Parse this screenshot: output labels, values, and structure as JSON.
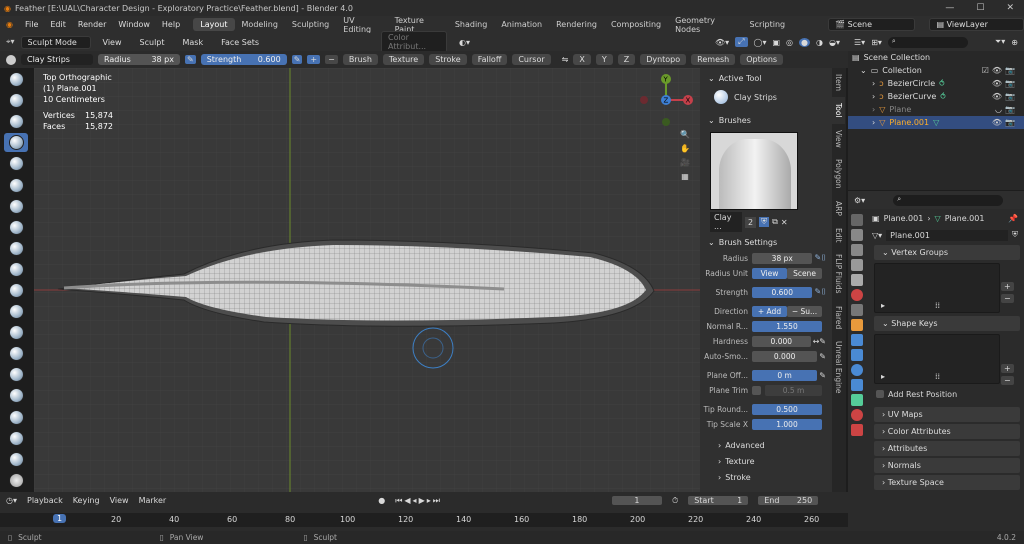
{
  "title": "Feather [E:\\UAL\\Character Design - Exploratory Practice\\Feather.blend] - Blender 4.0",
  "menus": [
    "File",
    "Edit",
    "Render",
    "Window",
    "Help"
  ],
  "workspaces": [
    "Layout",
    "Modeling",
    "Sculpting",
    "UV Editing",
    "Texture Paint",
    "Shading",
    "Animation",
    "Rendering",
    "Compositing",
    "Geometry Nodes",
    "Scripting"
  ],
  "scene": "Scene",
  "viewlayer": "ViewLayer",
  "vpmenu": {
    "mode": "Sculpt Mode",
    "items": [
      "View",
      "Sculpt",
      "Mask",
      "Face Sets"
    ],
    "color_attr": "Color Attribut..."
  },
  "toolhdr": {
    "brush": "Clay Strips",
    "radius_label": "Radius",
    "radius": "38 px",
    "strength_label": "Strength",
    "strength": "0.600",
    "menus": [
      "Brush",
      "Texture",
      "Stroke",
      "Falloff",
      "Cursor"
    ],
    "sym": [
      "X",
      "Y",
      "Z"
    ],
    "dyntopo": "Dyntopo",
    "remesh": "Remesh",
    "options": "Options"
  },
  "vpinfo": {
    "l1": "Top Orthographic",
    "l2": "(1) Plane.001",
    "l3": "10 Centimeters",
    "vlabel": "Vertices",
    "v": "15,874",
    "flabel": "Faces",
    "f": "15,872"
  },
  "gizmo": {
    "x": "X",
    "y": "Y",
    "z": "Z"
  },
  "npanel": {
    "active_tool": "Active Tool",
    "tool": "Clay Strips",
    "brushes": "Brushes",
    "brush_name": "Clay ...",
    "brush_users": "2",
    "brush_settings": "Brush Settings",
    "props": [
      {
        "l": "Radius",
        "v": "38 px"
      },
      {
        "l": "Radius Unit",
        "v": "View",
        "v2": "Scene"
      },
      {
        "l": "Strength",
        "v": "0.600"
      },
      {
        "l": "Direction",
        "v": "+ Add",
        "v2": "− Su..."
      },
      {
        "l": "Normal R...",
        "v": "1.550"
      },
      {
        "l": "Hardness",
        "v": "0.000"
      },
      {
        "l": "Auto-Smo...",
        "v": "0.000"
      },
      {
        "l": "Plane Off...",
        "v": "0 m"
      },
      {
        "l": "Plane Trim",
        "v": "0.5 m"
      },
      {
        "l": "Tip Round...",
        "v": "0.500"
      },
      {
        "l": "Tip Scale X",
        "v": "1.000"
      }
    ],
    "sub": [
      "Advanced",
      "Texture",
      "Stroke"
    ]
  },
  "ntabs": [
    "Item",
    "Tool",
    "View",
    "Polygon",
    "ARP",
    "Edit",
    "FLIP Fluids",
    "Flared",
    "Unreal Engine"
  ],
  "outliner": {
    "root": "Scene Collection",
    "items": [
      {
        "name": "Collection"
      },
      {
        "name": "BezierCircle"
      },
      {
        "name": "BezierCurve"
      },
      {
        "name": "Plane"
      },
      {
        "name": "Plane.001"
      }
    ]
  },
  "props": {
    "obj": "Plane.001",
    "mesh": "Plane.001",
    "data": "Plane.001",
    "vertex_groups": "Vertex Groups",
    "shape_keys": "Shape Keys",
    "add_rest": "Add Rest Position",
    "sections": [
      "UV Maps",
      "Color Attributes",
      "Attributes",
      "Normals",
      "Texture Space"
    ]
  },
  "timeline": {
    "menus": [
      "Playback",
      "Keying",
      "View",
      "Marker"
    ],
    "frame": "1",
    "start_label": "Start",
    "start": "1",
    "end_label": "End",
    "end": "250",
    "ticks": [
      "1",
      "20",
      "40",
      "60",
      "80",
      "100",
      "120",
      "140",
      "160",
      "180",
      "200",
      "220",
      "240",
      "260"
    ]
  },
  "status": {
    "s1": "Sculpt",
    "s2": "Pan View",
    "s3": "Sculpt",
    "ver": "4.0.2"
  }
}
